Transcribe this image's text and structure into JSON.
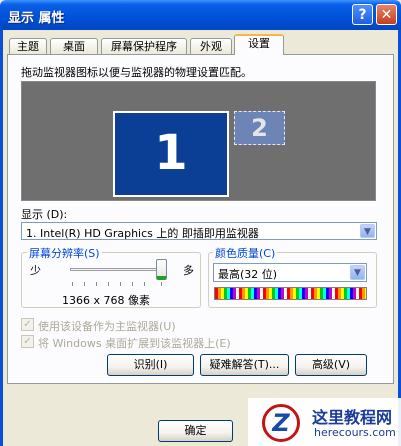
{
  "window": {
    "title": "显示 属性",
    "help_glyph": "?",
    "close_glyph": "✕"
  },
  "tabs": [
    {
      "label": "主题"
    },
    {
      "label": "桌面"
    },
    {
      "label": "屏幕保护程序"
    },
    {
      "label": "外观"
    },
    {
      "label": "设置",
      "active": true
    }
  ],
  "settings": {
    "instruction": "拖动监视器图标以便与监视器的物理设置匹配。",
    "monitors": {
      "primary_number": "1",
      "secondary_number": "2"
    },
    "display_label": "显示 (D):",
    "display_value": "1. Intel(R) HD Graphics 上的 即插即用监视器",
    "resolution": {
      "title": "屏幕分辨率(S)",
      "min_label": "少",
      "max_label": "多",
      "value_text": "1366 x 768 像素",
      "slider_level_percent": 100
    },
    "color_quality": {
      "title": "颜色质量(C)",
      "value": "最高(32 位)"
    },
    "checkbox_primary": {
      "label": "使用该设备作为主监视器(U)",
      "checked": true,
      "enabled": false
    },
    "checkbox_extend": {
      "label": "将 Windows 桌面扩展到该监视器上(E)",
      "checked": true,
      "enabled": false
    },
    "buttons": {
      "identify": "识别(I)",
      "troubleshoot": "疑难解答(T)...",
      "advanced": "高级(V)"
    }
  },
  "footer": {
    "ok": "确定"
  },
  "watermark": {
    "logo_letter": "Z",
    "title": "这里教程网",
    "url": "herecours.com"
  },
  "colors": {
    "titlebar": "#0050d8",
    "monitor_primary": "#0b3f96",
    "group_title": "#0046d5",
    "accent_tab": "#f7b64a"
  }
}
